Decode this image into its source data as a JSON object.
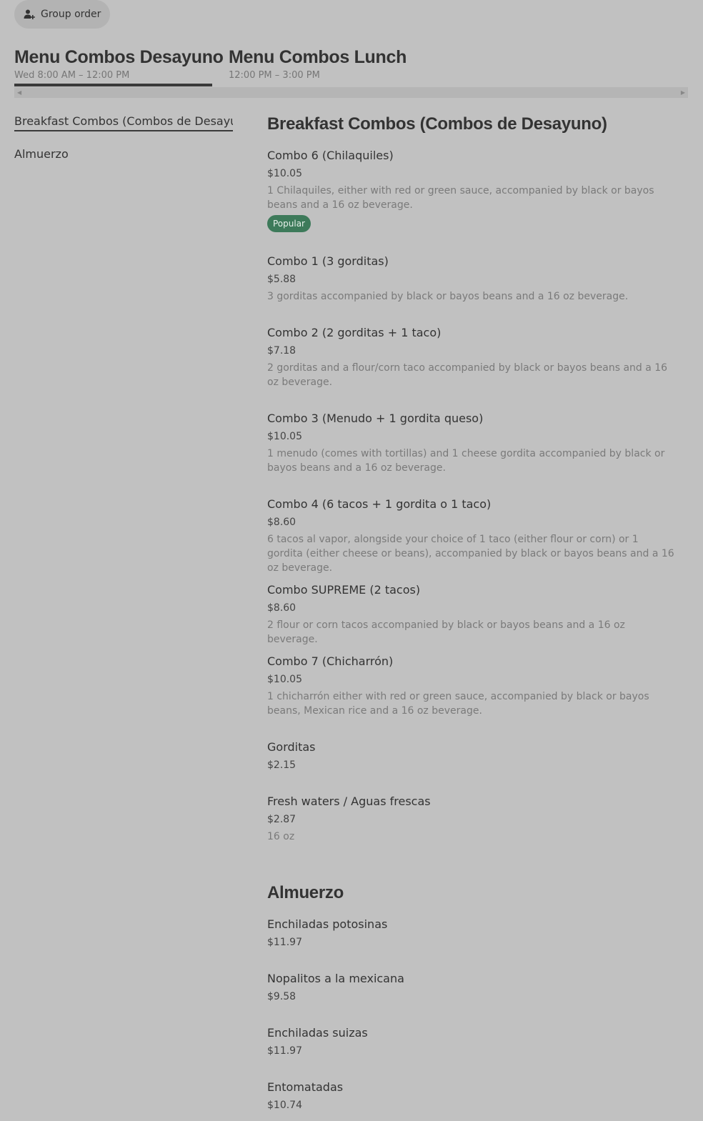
{
  "group_order": {
    "label": "Group order",
    "icon": "person-add-icon"
  },
  "menus": [
    {
      "title": "Menu Combos Desayuno",
      "hours": "Wed 8:00 AM – 12:00 PM"
    },
    {
      "title": "Menu Combos Lunch",
      "hours": "12:00 PM – 3:00 PM"
    }
  ],
  "sidebar": {
    "items": [
      {
        "label": "Breakfast Combos (Combos de Desayuno)"
      },
      {
        "label": "Almuerzo"
      }
    ]
  },
  "sections": [
    {
      "title": "Breakfast Combos (Combos de Desayuno)",
      "items": [
        {
          "name": "Combo 6 (Chilaquiles)",
          "price": "$10.05",
          "description": "1 Chilaquiles, either with red or green sauce, accompanied by black or bayos beans and a 16 oz beverage.",
          "badge": "Popular"
        },
        {
          "name": "Combo 1 (3 gorditas)",
          "price": "$5.88",
          "description": "3 gorditas accompanied by black or bayos beans and a 16 oz beverage."
        },
        {
          "name": "Combo 2 (2 gorditas + 1 taco)",
          "price": "$7.18",
          "description": "2 gorditas and a flour/corn taco accompanied by black or bayos beans and a 16 oz beverage."
        },
        {
          "name": "Combo 3 (Menudo + 1 gordita queso)",
          "price": "$10.05",
          "description": "1 menudo (comes with tortillas) and 1 cheese gordita accompanied by black or bayos beans and a 16 oz beverage."
        },
        {
          "name": "Combo 4 (6 tacos + 1 gordita o 1 taco)",
          "price": "$8.60",
          "description": "6 tacos al vapor, alongside your choice of 1 taco (either flour or corn) or 1 gordita (either cheese or beans), accompanied by black or bayos beans and a 16 oz beverage."
        },
        {
          "name": "Combo SUPREME (2 tacos)",
          "price": "$8.60",
          "description": "2 flour or corn tacos accompanied by black or bayos beans and a 16 oz beverage."
        },
        {
          "name": "Combo 7 (Chicharrón)",
          "price": "$10.05",
          "description": "1 chicharrón either with red or green sauce, accompanied by black or bayos beans, Mexican rice and a 16 oz beverage."
        },
        {
          "name": "Gorditas",
          "price": "$2.15"
        },
        {
          "name": "Fresh waters / Aguas frescas",
          "price": "$2.87",
          "description": "16 oz"
        }
      ]
    },
    {
      "title": "Almuerzo",
      "items": [
        {
          "name": "Enchiladas potosinas",
          "price": "$11.97"
        },
        {
          "name": "Nopalitos a la mexicana",
          "price": "$9.58"
        },
        {
          "name": "Enchiladas suizas",
          "price": "$11.97"
        },
        {
          "name": "Entomatadas",
          "price": "$10.74"
        }
      ]
    }
  ]
}
